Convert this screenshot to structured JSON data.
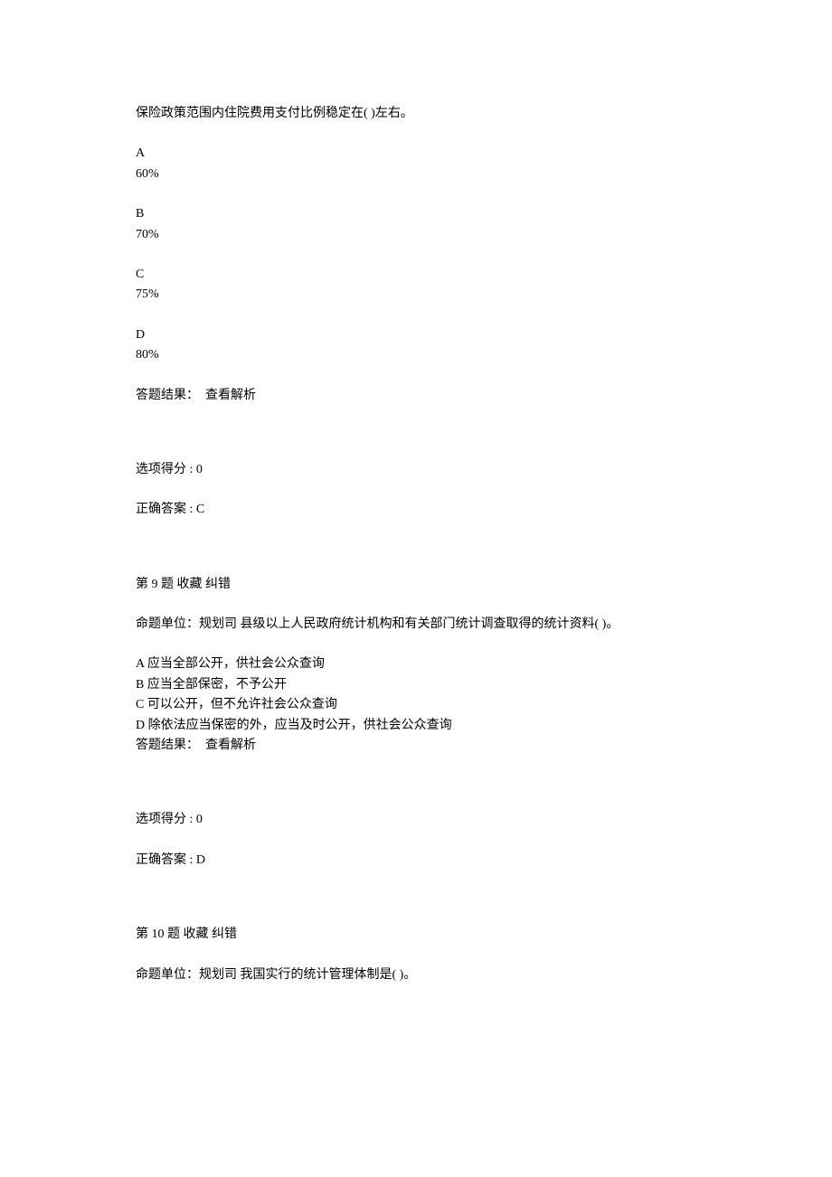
{
  "q8": {
    "stem": "保险政策范围内住院费用支付比例稳定在( )左右。",
    "options": [
      {
        "letter": "A",
        "value": "60%"
      },
      {
        "letter": "B",
        "value": "70%"
      },
      {
        "letter": "C",
        "value": "75%"
      },
      {
        "letter": "D",
        "value": "80%"
      }
    ],
    "result_label": "答题结果：  查看解析",
    "score_line": "选项得分 : 0",
    "answer_line": "正确答案 : C"
  },
  "q9": {
    "header": "第 9 题 收藏 纠错",
    "stem": "命题单位：规划司 县级以上人民政府统计机构和有关部门统计调查取得的统计资料( )。",
    "options": [
      "A 应当全部公开，供社会公众查询",
      "B 应当全部保密，不予公开",
      "C 可以公开，但不允许社会公众查询",
      "D 除依法应当保密的外，应当及时公开，供社会公众查询"
    ],
    "result_label": "答题结果：  查看解析",
    "score_line": "选项得分 : 0",
    "answer_line": "正确答案 : D"
  },
  "q10": {
    "header": "第 10 题 收藏 纠错",
    "stem": "命题单位：规划司 我国实行的统计管理体制是( )。"
  }
}
